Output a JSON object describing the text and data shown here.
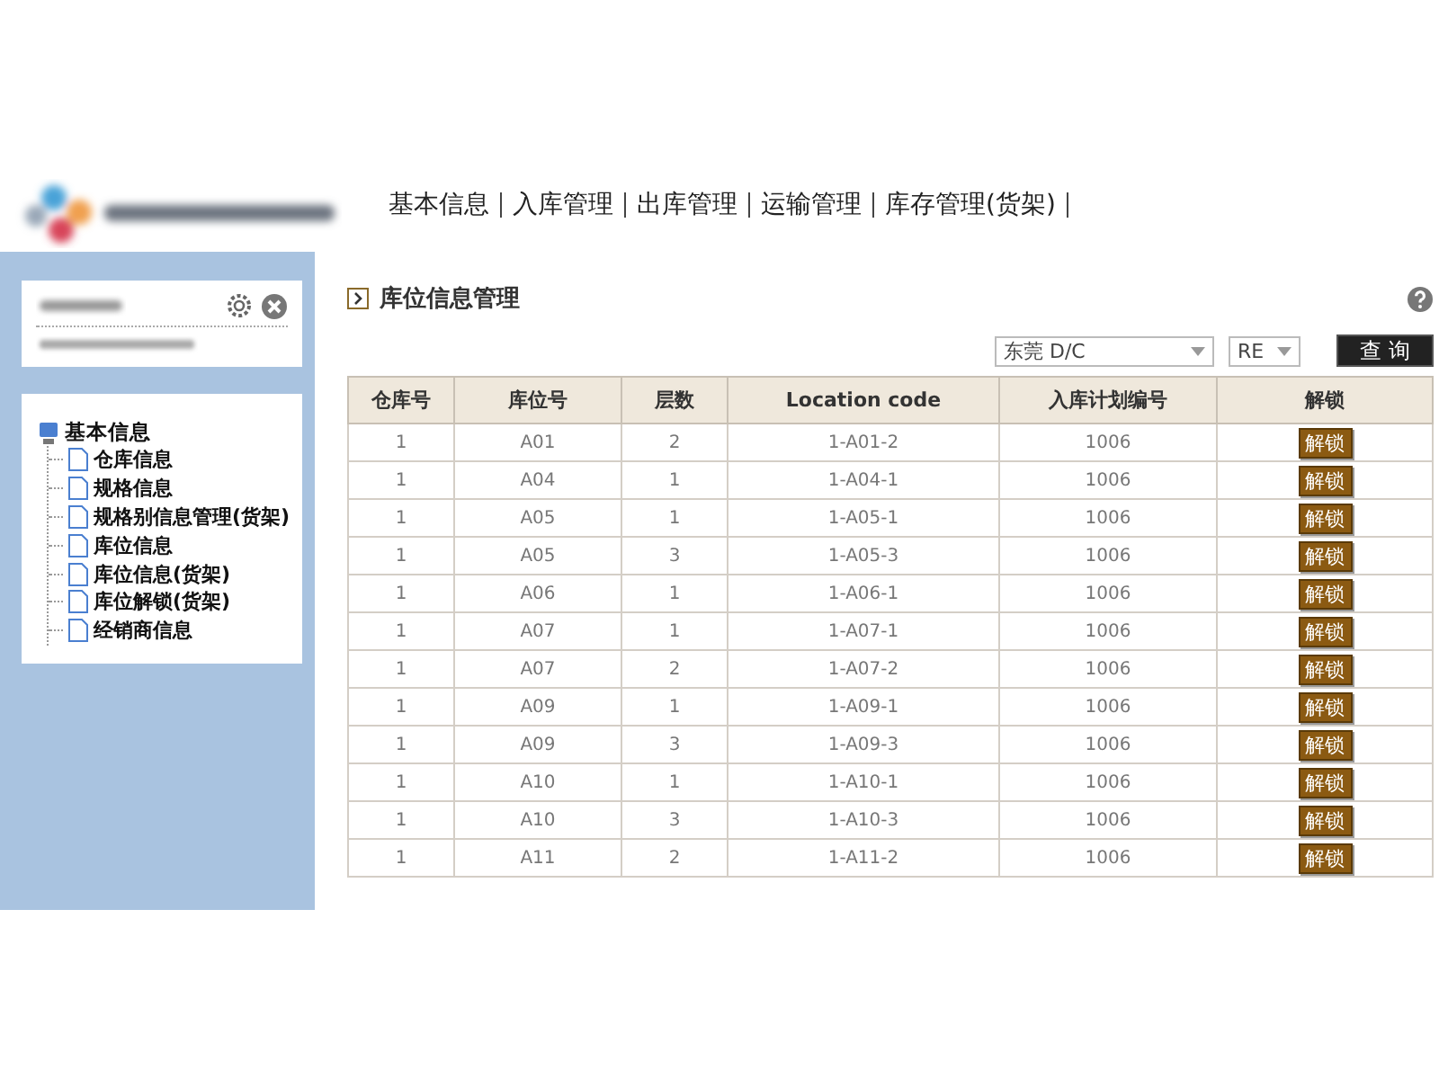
{
  "nav": {
    "items": [
      {
        "label": "基本信息"
      },
      {
        "label": "入库管理"
      },
      {
        "label": "出库管理"
      },
      {
        "label": "运输管理"
      },
      {
        "label": "库存管理(货架)"
      }
    ]
  },
  "sidebar": {
    "tree": {
      "label": "基本信息",
      "expanded": true,
      "children": [
        {
          "label": "仓库信息"
        },
        {
          "label": "规格信息"
        },
        {
          "label": "规格别信息管理(货架)"
        },
        {
          "label": "库位信息"
        },
        {
          "label": "库位信息(货架)"
        },
        {
          "label": "库位解锁(货架)"
        },
        {
          "label": "经销商信息"
        }
      ]
    }
  },
  "page": {
    "title": "库位信息管理"
  },
  "filters": {
    "warehouse": "东莞  D/C",
    "type": "RE",
    "query_button": "查 询"
  },
  "table": {
    "columns": [
      "仓库号",
      "库位号",
      "层数",
      "Location code",
      "入库计划编号",
      "解锁"
    ],
    "rows": [
      {
        "cells": [
          "1",
          "A01",
          "2",
          "1-A01-2",
          "1006"
        ],
        "action": "解锁"
      },
      {
        "cells": [
          "1",
          "A04",
          "1",
          "1-A04-1",
          "1006"
        ],
        "action": "解锁"
      },
      {
        "cells": [
          "1",
          "A05",
          "1",
          "1-A05-1",
          "1006"
        ],
        "action": "解锁"
      },
      {
        "cells": [
          "1",
          "A05",
          "3",
          "1-A05-3",
          "1006"
        ],
        "action": "解锁"
      },
      {
        "cells": [
          "1",
          "A06",
          "1",
          "1-A06-1",
          "1006"
        ],
        "action": "解锁"
      },
      {
        "cells": [
          "1",
          "A07",
          "1",
          "1-A07-1",
          "1006"
        ],
        "action": "解锁"
      },
      {
        "cells": [
          "1",
          "A07",
          "2",
          "1-A07-2",
          "1006"
        ],
        "action": "解锁"
      },
      {
        "cells": [
          "1",
          "A09",
          "1",
          "1-A09-1",
          "1006"
        ],
        "action": "解锁"
      },
      {
        "cells": [
          "1",
          "A09",
          "3",
          "1-A09-3",
          "1006"
        ],
        "action": "解锁"
      },
      {
        "cells": [
          "1",
          "A10",
          "1",
          "1-A10-1",
          "1006"
        ],
        "action": "解锁"
      },
      {
        "cells": [
          "1",
          "A10",
          "3",
          "1-A10-3",
          "1006"
        ],
        "action": "解锁"
      },
      {
        "cells": [
          "1",
          "A11",
          "2",
          "1-A11-2",
          "1006"
        ],
        "action": "解锁"
      }
    ]
  }
}
